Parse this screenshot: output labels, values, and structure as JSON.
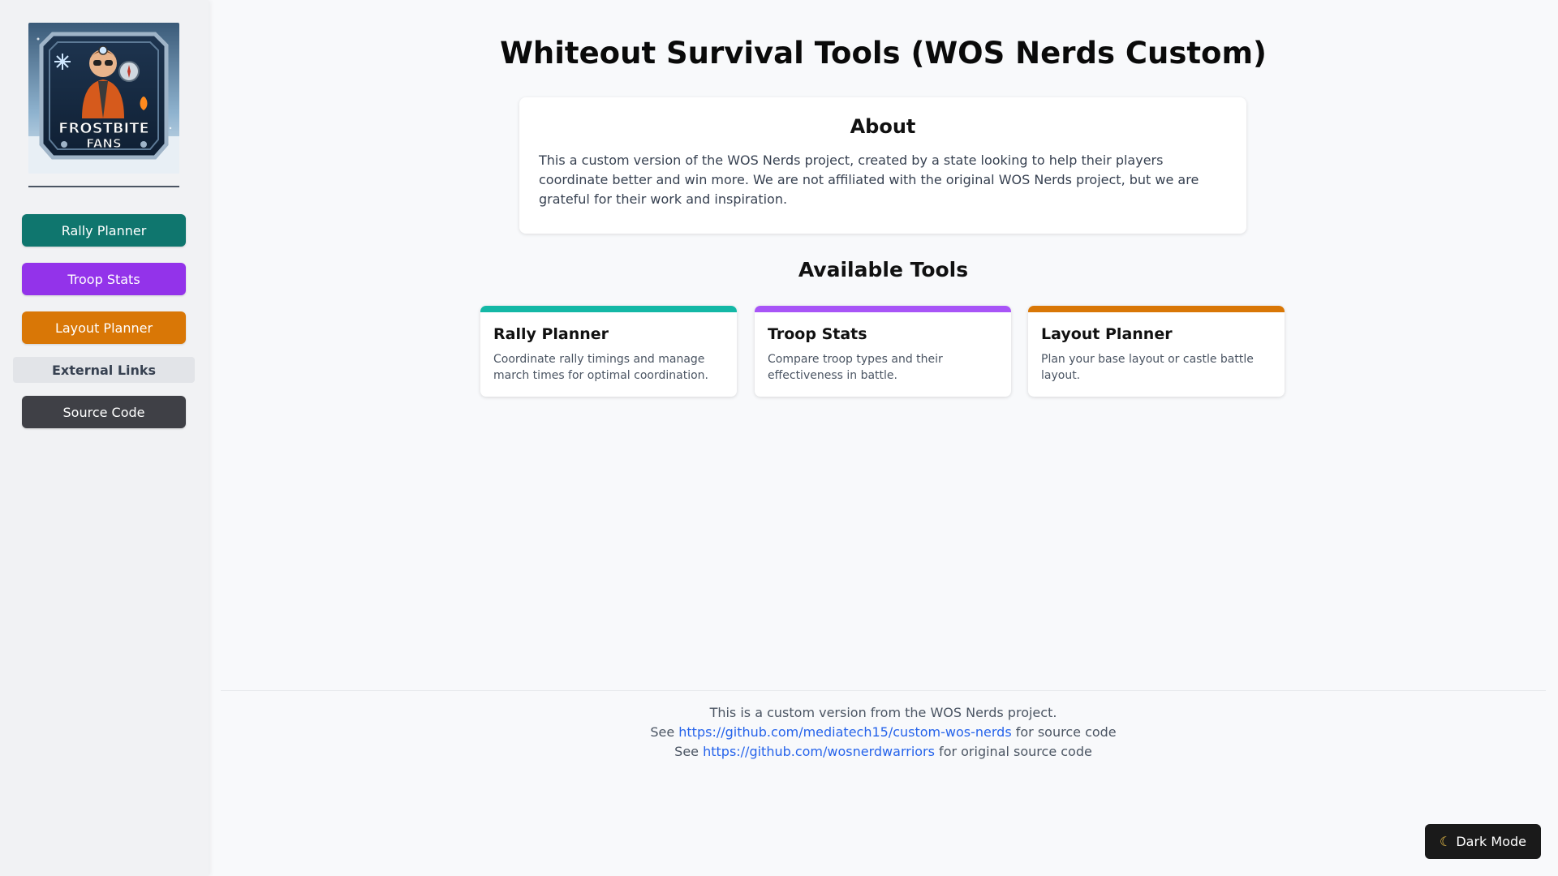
{
  "sidebar": {
    "logo_text": "FROSTBITE FANS",
    "nav": [
      {
        "label": "Rally Planner",
        "color": "#0f766e"
      },
      {
        "label": "Troop Stats",
        "color": "#9333ea"
      },
      {
        "label": "Layout Planner",
        "color": "#d97706"
      }
    ],
    "external_links_header": "External Links",
    "source_code_label": "Source Code"
  },
  "main": {
    "title": "Whiteout Survival Tools (WOS Nerds Custom)",
    "about": {
      "title": "About",
      "text": "This a custom version of the WOS Nerds project, created by a state looking to help their players coordinate better and win more. We are not affiliated with the original WOS Nerds project, but we are grateful for their work and inspiration."
    },
    "tools_title": "Available Tools",
    "tools": [
      {
        "title": "Rally Planner",
        "description": "Coordinate rally timings and manage march times for optimal coordination.",
        "accent": "#14b8a6"
      },
      {
        "title": "Troop Stats",
        "description": "Compare troop types and their effectiveness in battle.",
        "accent": "#a855f7"
      },
      {
        "title": "Layout Planner",
        "description": "Plan your base layout or castle battle layout.",
        "accent": "#d97706"
      }
    ]
  },
  "footer": {
    "line1": "This is a custom version from the WOS Nerds project.",
    "line2_prefix": "See ",
    "line2_link": "https://github.com/mediatech15/custom-wos-nerds",
    "line2_suffix": " for source code",
    "line3_prefix": "See ",
    "line3_link": "https://github.com/wosnerdwarriors",
    "line3_suffix": " for original source code"
  },
  "dark_mode": {
    "icon": "moon-icon",
    "label": "Dark Mode"
  }
}
